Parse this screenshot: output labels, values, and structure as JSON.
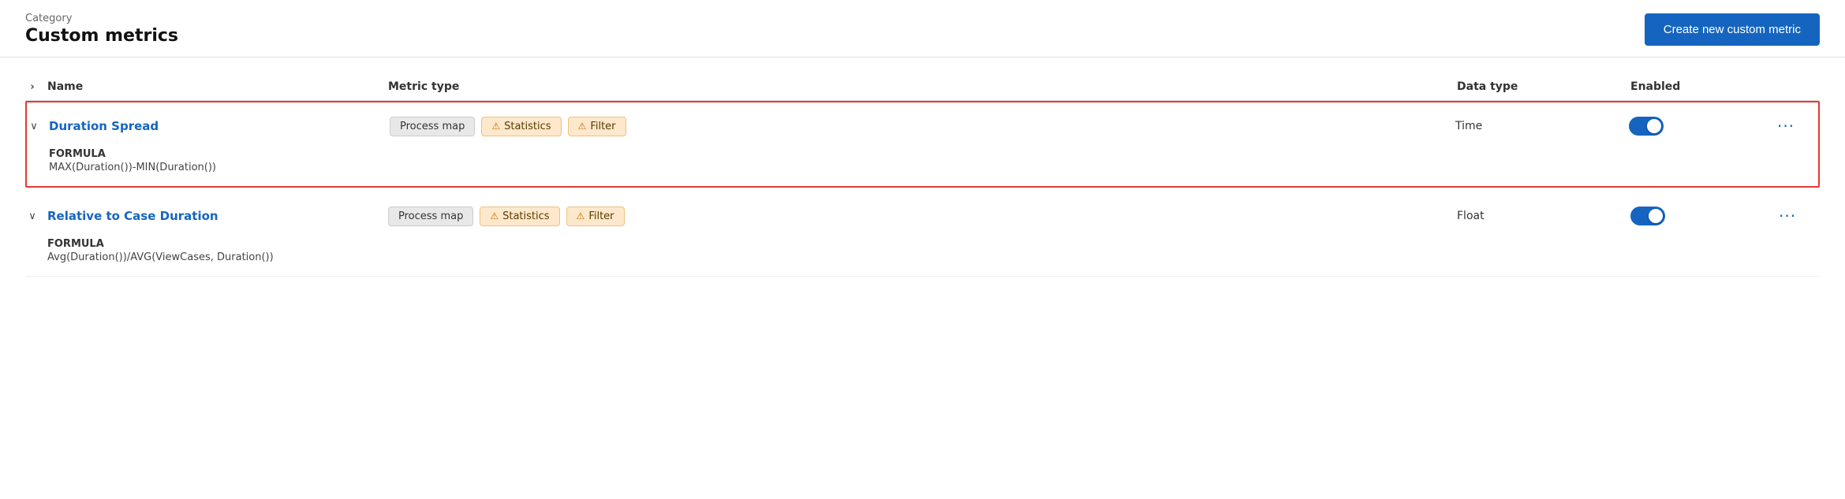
{
  "header": {
    "category_label": "Category",
    "page_title": "Custom metrics",
    "create_btn_label": "Create new custom metric"
  },
  "table": {
    "col_expand_icon": "›",
    "col_name": "Name",
    "col_metric_type": "Metric type",
    "col_data_type": "Data type",
    "col_enabled": "Enabled"
  },
  "metrics": [
    {
      "id": "duration-spread",
      "name": "Duration Spread",
      "expanded": true,
      "highlighted": true,
      "metric_types": [
        {
          "label": "Process map",
          "style": "gray"
        },
        {
          "label": "Statistics",
          "style": "orange",
          "warn": true
        },
        {
          "label": "Filter",
          "style": "orange",
          "warn": true
        }
      ],
      "data_type": "Time",
      "enabled": true,
      "formula_label": "FORMULA",
      "formula_value": "MAX(Duration())-MIN(Duration())"
    },
    {
      "id": "relative-to-case-duration",
      "name": "Relative to Case Duration",
      "expanded": true,
      "highlighted": false,
      "metric_types": [
        {
          "label": "Process map",
          "style": "gray"
        },
        {
          "label": "Statistics",
          "style": "orange",
          "warn": true
        },
        {
          "label": "Filter",
          "style": "orange",
          "warn": true
        }
      ],
      "data_type": "Float",
      "enabled": true,
      "formula_label": "FORMULA",
      "formula_value": "Avg(Duration())/AVG(ViewCases, Duration())"
    }
  ],
  "icons": {
    "chevron_right": "›",
    "chevron_down": "∨",
    "warning": "⚠",
    "more": "•••"
  }
}
